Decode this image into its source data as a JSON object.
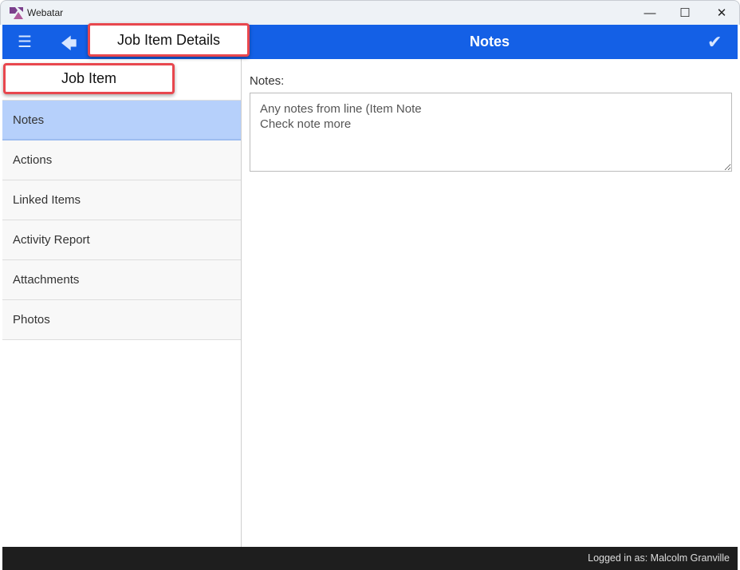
{
  "window": {
    "title": "Webatar"
  },
  "header": {
    "title": "Notes"
  },
  "callouts": {
    "details": "Job Item Details",
    "job_item": "Job Item"
  },
  "sidebar": {
    "items": [
      {
        "label": "Notes"
      },
      {
        "label": "Actions"
      },
      {
        "label": "Linked Items"
      },
      {
        "label": "Activity Report"
      },
      {
        "label": "Attachments"
      },
      {
        "label": "Photos"
      }
    ]
  },
  "main": {
    "notes_label": "Notes:",
    "notes_value": "Any notes from line (Item Note\nCheck note more"
  },
  "footer": {
    "status": "Logged in as: Malcolm Granville"
  },
  "colors": {
    "header": "#1460e6",
    "selected": "#b6d0fb",
    "footer": "#1e1e1e"
  }
}
